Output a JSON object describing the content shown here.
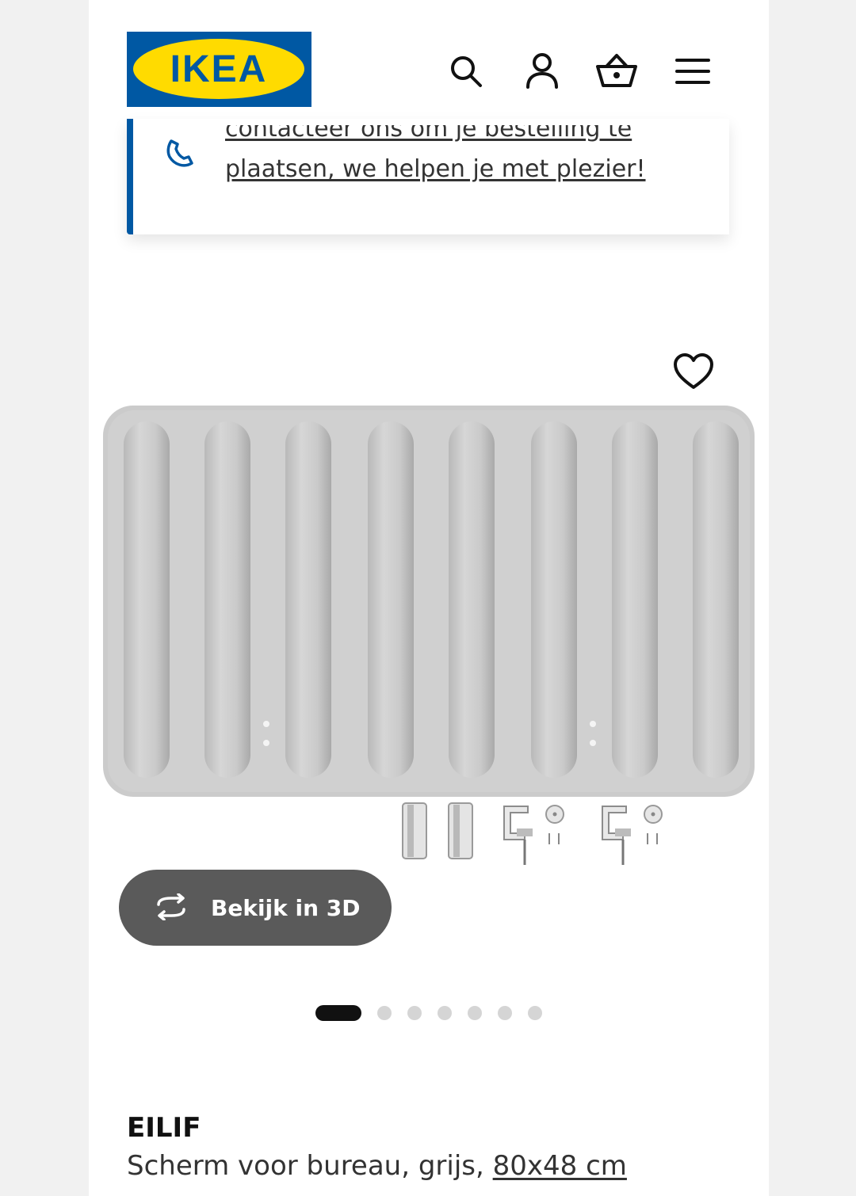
{
  "header": {
    "logo_text": "IKEA",
    "icons": [
      "search-icon",
      "account-icon",
      "basket-icon",
      "menu-icon"
    ]
  },
  "notice": {
    "line1": "contacteer ons om je bestelling te",
    "line2": "plaatsen, we helpen je met plezier!",
    "icon": "phone-icon"
  },
  "gallery": {
    "view3d_label": "Bekijk in 3D",
    "total_images": 7,
    "active_index": 0
  },
  "product": {
    "name": "EILIF",
    "description": "Scherm voor bureau, grijs,",
    "size": "80x48 cm"
  },
  "colors": {
    "brand_blue": "#0058a3",
    "brand_yellow": "#ffdb00",
    "button_grey": "#5a5a5a"
  }
}
